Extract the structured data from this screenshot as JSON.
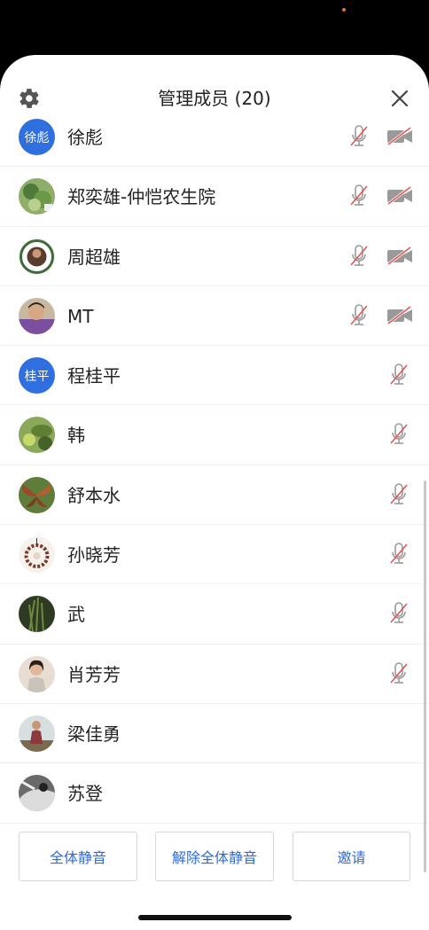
{
  "header": {
    "title": "管理成员 (20)"
  },
  "members": [
    {
      "name": "徐彪",
      "avatar_text": "徐彪",
      "avatar_type": "text",
      "mic_muted": true,
      "camera_off": true
    },
    {
      "name": "郑奕雄-仲恺农生院",
      "avatar_type": "photo-green-plant",
      "mic_muted": true,
      "camera_off": true
    },
    {
      "name": "周超雄",
      "avatar_type": "photo-badge",
      "mic_muted": true,
      "camera_off": true
    },
    {
      "name": "MT",
      "avatar_type": "photo-child",
      "mic_muted": true,
      "camera_off": true
    },
    {
      "name": "程桂平",
      "avatar_text": "桂平",
      "avatar_type": "text",
      "mic_muted": true,
      "camera_off": false
    },
    {
      "name": "韩",
      "avatar_type": "photo-leaf",
      "mic_muted": true,
      "camera_off": false
    },
    {
      "name": "舒本水",
      "avatar_type": "photo-butterfly",
      "mic_muted": true,
      "camera_off": false
    },
    {
      "name": "孙晓芳",
      "avatar_type": "photo-wreath",
      "mic_muted": true,
      "camera_off": false
    },
    {
      "name": "武",
      "avatar_type": "photo-grass",
      "mic_muted": true,
      "camera_off": false
    },
    {
      "name": "肖芳芳",
      "avatar_type": "photo-woman",
      "mic_muted": true,
      "camera_off": false
    },
    {
      "name": "梁佳勇",
      "avatar_type": "photo-person",
      "mic_muted": false,
      "camera_off": false
    },
    {
      "name": "苏登",
      "avatar_type": "photo-bw",
      "mic_muted": false,
      "camera_off": false
    }
  ],
  "footer": {
    "mute_all_label": "全体静音",
    "unmute_all_label": "解除全体静音",
    "invite_label": "邀请"
  },
  "colors": {
    "accent": "#2d6bd6",
    "avatar_blue": "#2f6fe0",
    "muted_red": "#e25555",
    "icon_gray": "#9a9a9a"
  }
}
